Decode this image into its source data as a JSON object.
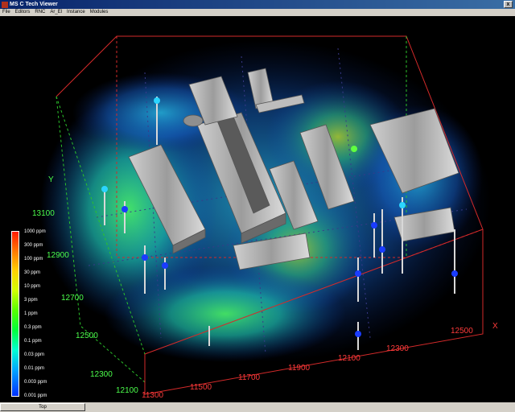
{
  "window": {
    "title": "C Tech Viewer",
    "brand": "MS",
    "controls": {
      "close": "x"
    }
  },
  "menu": [
    "File",
    "Editors",
    "RNC",
    "Ar_El",
    "Instance",
    "Modules"
  ],
  "view": {
    "y_axis_label": "Y",
    "y_ticks": [
      "13100",
      "12900",
      "12700",
      "12500",
      "12300",
      "12100"
    ],
    "x_ticks": [
      "11300",
      "11500",
      "11700",
      "11900",
      "12100",
      "12300",
      "12500"
    ],
    "x_axis_label": "X"
  },
  "legend": {
    "labels": [
      "1000 ppm",
      "300 ppm",
      "100 ppm",
      "30 ppm",
      "10 ppm",
      "3 ppm",
      "1 ppm",
      "0.3 ppm",
      "0.1 ppm",
      "0.03 ppm",
      "0.01 ppm",
      "0.003 ppm",
      "0.001 ppm"
    ]
  },
  "status": {
    "view_button": "Top"
  }
}
